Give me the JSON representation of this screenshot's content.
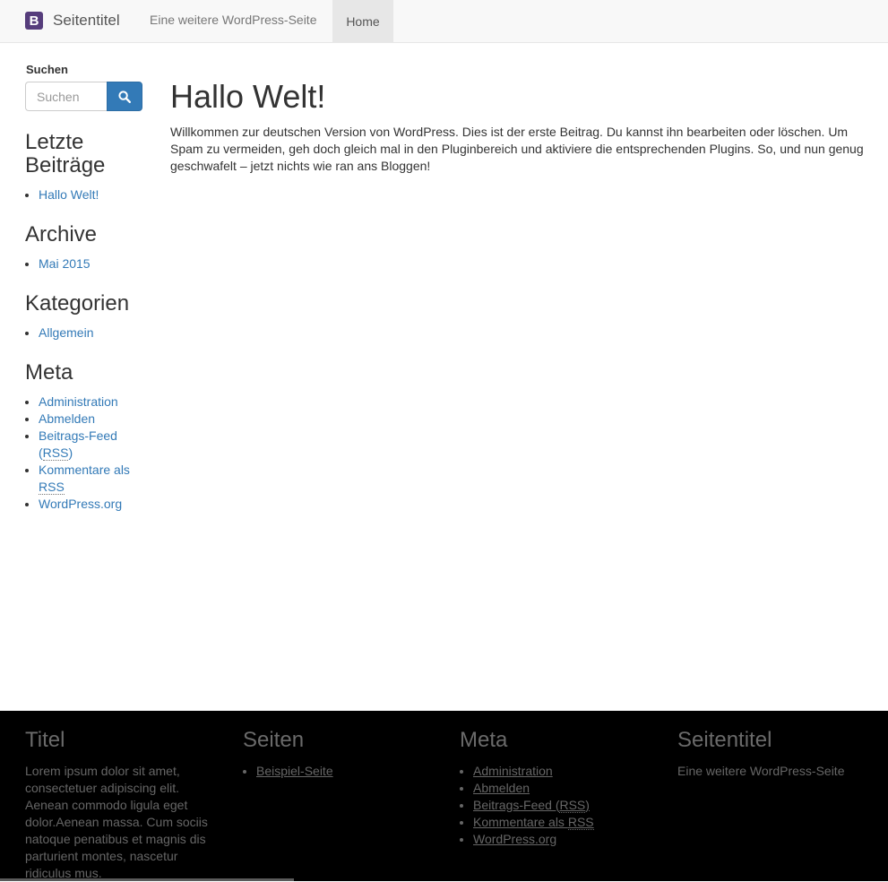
{
  "navbar": {
    "brand_logo": "B",
    "brand_title": "Seitentitel",
    "description": "Eine weitere WordPress-Seite",
    "home": "Home"
  },
  "sidebar": {
    "search_label": "Suchen",
    "search_placeholder": "Suchen",
    "recent_title": "Letzte Beiträge",
    "recent_items": [
      "Hallo Welt!"
    ],
    "archive_title": "Archive",
    "archive_items": [
      "Mai 2015"
    ],
    "categories_title": "Kategorien",
    "category_items": [
      "Allgemein"
    ],
    "meta_title": "Meta",
    "meta_items": {
      "admin": "Administration",
      "logout": "Abmelden",
      "feed_prefix": "Beitrags-Feed (",
      "rss": "RSS",
      "feed_suffix": ")",
      "comments_prefix": "Kommentare als ",
      "wordpress": "WordPress.org"
    }
  },
  "main": {
    "post_title": "Hallo Welt!",
    "post_body": "Willkommen zur deutschen Version von WordPress. Dies ist der erste Beitrag. Du kannst ihn bearbeiten oder löschen. Um Spam zu vermeiden, geh doch gleich mal in den Pluginbereich und aktiviere die entsprechenden Plugins. So, und nun genug geschwafelt – jetzt nichts wie ran ans Bloggen!"
  },
  "footer": {
    "col1_title": "Titel",
    "col1_text": "Lorem ipsum dolor sit amet, consectetuer adipiscing elit. Aenean commodo ligula eget dolor.Aenean massa. Cum sociis natoque penatibus et magnis dis parturient montes, nascetur ridiculus mus.",
    "col2_title": "Seiten",
    "col2_items": [
      "Beispiel-Seite"
    ],
    "col3_title": "Meta",
    "col3_items": {
      "admin": "Administration",
      "logout": "Abmelden",
      "feed_prefix": "Beitrags-Feed (",
      "rss": "RSS",
      "feed_suffix": ")",
      "comments_prefix": "Kommentare als ",
      "wordpress": "WordPress.org"
    },
    "col4_title": "Seitentitel",
    "col4_text": "Eine weitere WordPress-Seite"
  },
  "colors": {
    "link": "#337ab7",
    "brand_logo": "#563d7c",
    "footer_bg": "#000000"
  },
  "icons": {
    "search": "search-icon"
  }
}
